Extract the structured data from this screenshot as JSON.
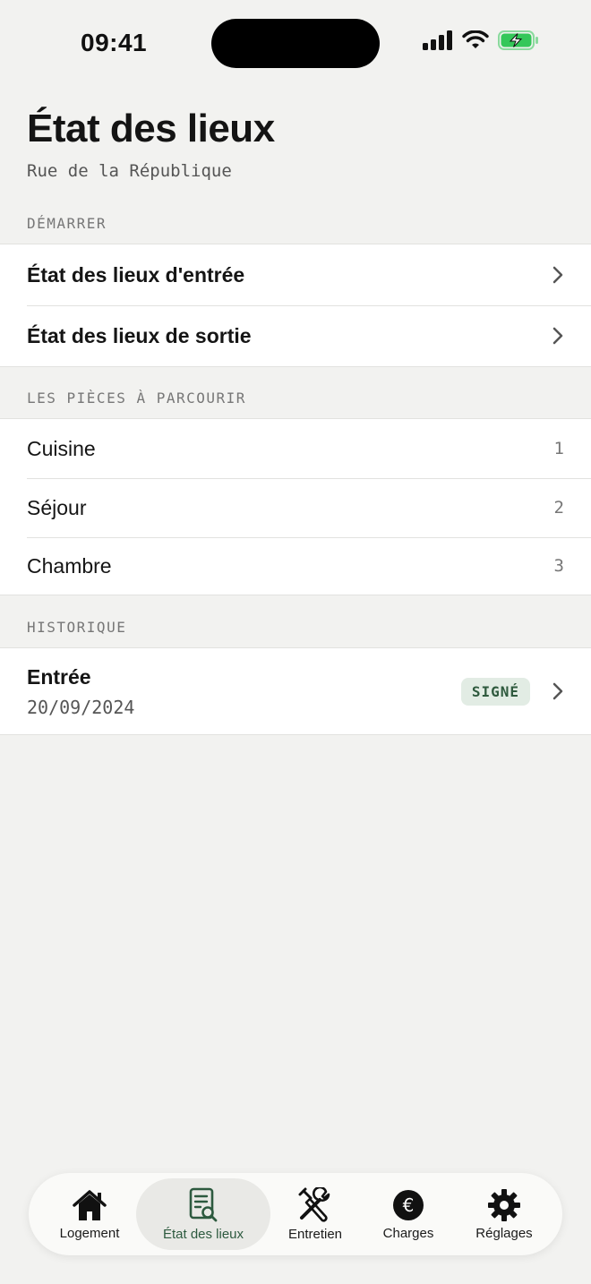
{
  "status_bar": {
    "time": "09:41"
  },
  "header": {
    "title": "État des lieux",
    "subtitle": "Rue de la République"
  },
  "sections": {
    "start": {
      "header": "DÉMARRER",
      "items": [
        {
          "label": "État des lieux d'entrée"
        },
        {
          "label": "État des lieux de sortie"
        }
      ]
    },
    "rooms": {
      "header": "LES PIÈCES À PARCOURIR",
      "items": [
        {
          "label": "Cuisine",
          "count": "1"
        },
        {
          "label": "Séjour",
          "count": "2"
        },
        {
          "label": "Chambre",
          "count": "3"
        }
      ]
    },
    "history": {
      "header": "HISTORIQUE",
      "items": [
        {
          "title": "Entrée",
          "date": "20/09/2024",
          "badge": "SIGNÉ"
        }
      ]
    }
  },
  "tabbar": {
    "tabs": [
      {
        "label": "Logement",
        "icon": "house-icon"
      },
      {
        "label": "État des lieux",
        "icon": "document-search-icon",
        "active": true
      },
      {
        "label": "Entretien",
        "icon": "tools-icon"
      },
      {
        "label": "Charges",
        "icon": "euro-icon"
      },
      {
        "label": "Réglages",
        "icon": "gear-icon"
      }
    ]
  },
  "colors": {
    "accent": "#2d5a3f",
    "background": "#f2f2f0",
    "badge_bg": "#e2ece4",
    "battery": "#34c759"
  }
}
